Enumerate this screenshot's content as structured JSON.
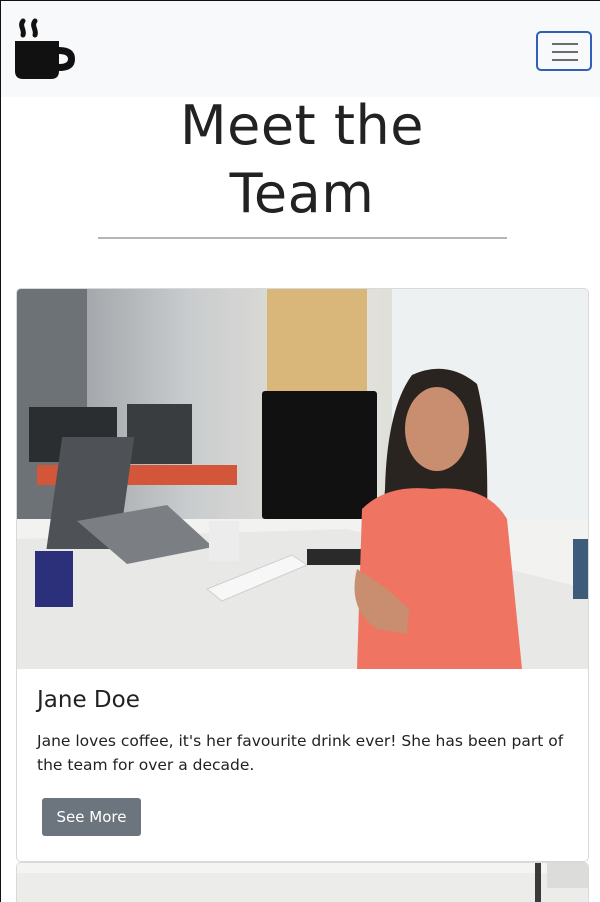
{
  "navbar": {
    "logo_icon": "coffee-mug-icon",
    "toggler_icon": "hamburger-menu-icon",
    "toggler_border_color": "#2f5fb8"
  },
  "header": {
    "title_line1": "Meet the",
    "title_line2": "Team"
  },
  "members": [
    {
      "name": "Jane Doe",
      "bio": "Jane loves coffee, it's her favourite drink ever! She has been part of the team for over a decade.",
      "button_label": "See More",
      "button_color": "#6c757d"
    }
  ]
}
